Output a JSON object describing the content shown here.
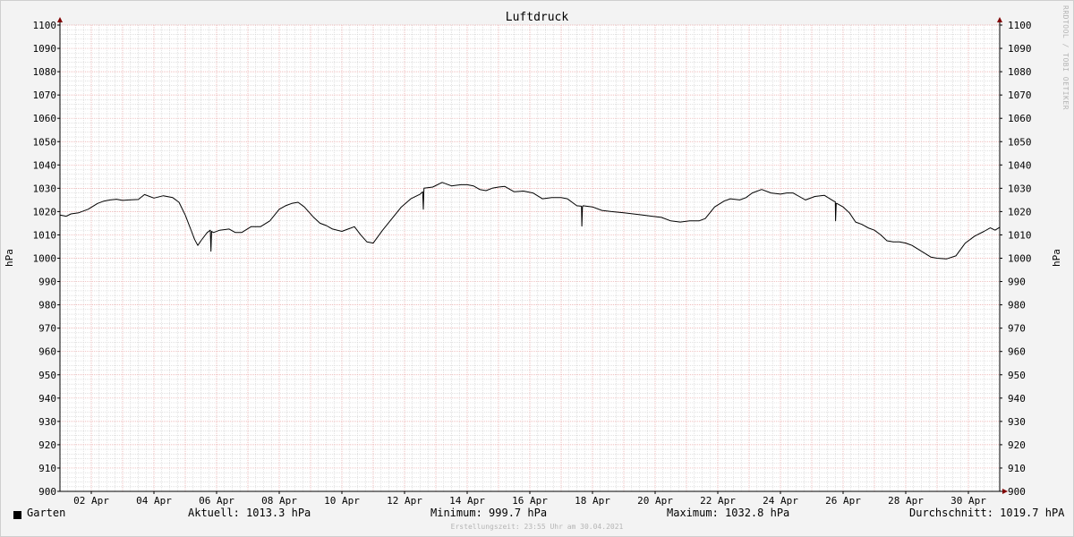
{
  "watermark": "RRDTOOL / TOBI OETIKER",
  "legend": {
    "series_name": "Garten",
    "current": "Aktuell: 1013.3 hPa",
    "minimum": "Minimum: 999.7 hPa",
    "maximum": "Maximum: 1032.8 hPa",
    "average": "Durchschnitt: 1019.7 hPA"
  },
  "footer": "Erstellungszeit: 23:55 Uhr am 30.04.2021",
  "colors": {
    "line": "#000000",
    "major_grid": "#e9a3a3",
    "minor_grid": "#cfcfcf",
    "plot_bg": "#ffffff",
    "axis": "#000000",
    "arrow": "#800000"
  },
  "chart_data": {
    "type": "line",
    "title": "Luftdruck",
    "ylabel": "hPa",
    "y2label": "hPa",
    "ylim": [
      900,
      1100
    ],
    "xlim": [
      0.0,
      30.0
    ],
    "x_unit": "days since 01 Apr 2021",
    "yticks": [
      900,
      910,
      920,
      930,
      940,
      950,
      960,
      970,
      980,
      990,
      1000,
      1010,
      1020,
      1030,
      1040,
      1050,
      1060,
      1070,
      1080,
      1090,
      1100
    ],
    "xticks": [
      {
        "x": 1,
        "label": "02 Apr"
      },
      {
        "x": 3,
        "label": "04 Apr"
      },
      {
        "x": 5,
        "label": "06 Apr"
      },
      {
        "x": 7,
        "label": "08 Apr"
      },
      {
        "x": 9,
        "label": "10 Apr"
      },
      {
        "x": 11,
        "label": "12 Apr"
      },
      {
        "x": 13,
        "label": "14 Apr"
      },
      {
        "x": 15,
        "label": "16 Apr"
      },
      {
        "x": 17,
        "label": "18 Apr"
      },
      {
        "x": 19,
        "label": "20 Apr"
      },
      {
        "x": 21,
        "label": "22 Apr"
      },
      {
        "x": 23,
        "label": "24 Apr"
      },
      {
        "x": 25,
        "label": "26 Apr"
      },
      {
        "x": 27,
        "label": "28 Apr"
      },
      {
        "x": 29,
        "label": "30 Apr"
      }
    ],
    "grid": true,
    "legend_position": "bottom",
    "series": [
      {
        "name": "Garten",
        "x": [
          0,
          0.2,
          0.35,
          0.6,
          0.9,
          1.2,
          1.4,
          1.6,
          1.8,
          2.0,
          2.2,
          2.5,
          2.7,
          3.0,
          3.3,
          3.6,
          3.8,
          4.0,
          4.2,
          4.3,
          4.4,
          4.5,
          4.7,
          4.8,
          4.82,
          4.84,
          4.9,
          5.1,
          5.4,
          5.6,
          5.8,
          6.1,
          6.4,
          6.7,
          7.0,
          7.2,
          7.4,
          7.6,
          7.8,
          8.1,
          8.3,
          8.5,
          8.7,
          9.0,
          9.2,
          9.4,
          9.6,
          9.8,
          10.0,
          10.3,
          10.6,
          10.9,
          11.2,
          11.5,
          11.58,
          11.6,
          11.62,
          11.9,
          12.2,
          12.5,
          12.8,
          13.0,
          13.2,
          13.4,
          13.6,
          13.8,
          14.0,
          14.2,
          14.5,
          14.8,
          15.1,
          15.4,
          15.7,
          16.0,
          16.2,
          16.5,
          16.65,
          16.66,
          16.68,
          16.7,
          17.0,
          17.3,
          17.6,
          18.0,
          18.3,
          18.6,
          18.9,
          19.2,
          19.5,
          19.8,
          20.1,
          20.4,
          20.6,
          20.9,
          21.2,
          21.4,
          21.7,
          21.9,
          22.1,
          22.4,
          22.7,
          23.0,
          23.2,
          23.4,
          23.6,
          23.8,
          24.1,
          24.4,
          24.7,
          24.75,
          24.76,
          24.78,
          24.8,
          25.0,
          25.2,
          25.4,
          25.6,
          25.8,
          26.0,
          26.2,
          26.4,
          26.6,
          26.8,
          27.0,
          27.2,
          27.5,
          27.8,
          28.0,
          28.3,
          28.6,
          28.9,
          29.2,
          29.5,
          29.7,
          29.85,
          30.0
        ],
        "y": [
          1018.5,
          1018.0,
          1019.0,
          1019.5,
          1021.0,
          1023.5,
          1024.5,
          1025.0,
          1025.3,
          1024.8,
          1025.0,
          1025.2,
          1027.3,
          1025.8,
          1026.8,
          1026.0,
          1024.0,
          1018.5,
          1011.5,
          1008.0,
          1005.5,
          1007.5,
          1011.0,
          1012.0,
          1003.0,
          1011.5,
          1011.0,
          1012.0,
          1012.5,
          1011.0,
          1011.0,
          1013.5,
          1013.5,
          1016.0,
          1021.0,
          1022.5,
          1023.5,
          1024.0,
          1022.0,
          1017.5,
          1015.0,
          1014.0,
          1012.5,
          1011.5,
          1012.5,
          1013.5,
          1010.0,
          1007.0,
          1006.5,
          1012.0,
          1017.0,
          1022.0,
          1025.5,
          1027.5,
          1028.5,
          1021.0,
          1030.0,
          1030.5,
          1032.5,
          1031.0,
          1031.5,
          1031.5,
          1031.0,
          1029.5,
          1029.0,
          1030.0,
          1030.5,
          1030.8,
          1028.5,
          1028.8,
          1028.0,
          1025.5,
          1026.0,
          1026.0,
          1025.5,
          1022.5,
          1022.3,
          1013.8,
          1022.0,
          1022.5,
          1022.0,
          1020.5,
          1020.0,
          1019.5,
          1019.0,
          1018.5,
          1018.0,
          1017.5,
          1016.0,
          1015.5,
          1016.0,
          1016.0,
          1017.0,
          1022.0,
          1024.5,
          1025.5,
          1025.0,
          1026.0,
          1028.0,
          1029.5,
          1028.0,
          1027.5,
          1028.0,
          1028.0,
          1026.5,
          1025.0,
          1026.5,
          1027.0,
          1024.5,
          1024.2,
          1016.0,
          1023.5,
          1023.5,
          1022.0,
          1019.5,
          1015.5,
          1014.5,
          1013.0,
          1012.0,
          1010.0,
          1007.5,
          1007.0,
          1007.0,
          1006.5,
          1005.5,
          1003.0,
          1000.5,
          1000.0,
          999.7,
          1001.0,
          1006.5,
          1009.5,
          1011.5,
          1013.0,
          1012.0,
          1013.3
        ]
      }
    ]
  }
}
